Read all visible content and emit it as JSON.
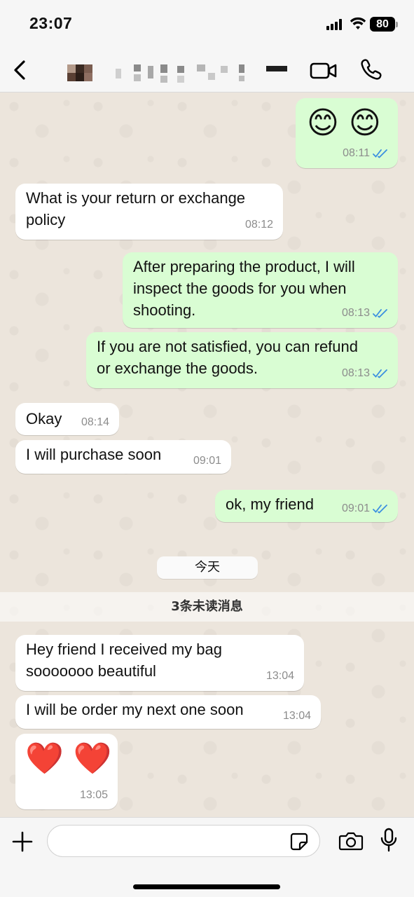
{
  "status_bar": {
    "time": "23:07",
    "battery": "80"
  },
  "chat": {
    "messages": [
      {
        "text": "😊 😊",
        "time": "08:11"
      },
      {
        "text": "What is your return or exchange\npolicy",
        "time": "08:12"
      },
      {
        "text": "After preparing the product, I will\ninspect the goods for you when\nshooting.",
        "time": "08:13"
      },
      {
        "text": "If you are not satisfied, you can refund\nor exchange the goods.",
        "time": "08:13"
      },
      {
        "text": "Okay",
        "time": "08:14"
      },
      {
        "text": "I will purchase soon",
        "time": "09:01"
      },
      {
        "text": "ok, my friend",
        "time": "09:01"
      },
      {
        "text": "Hey friend I received my bag\nsooooooo beautiful",
        "time": "13:04"
      },
      {
        "text": "I will be order my next one soon",
        "time": "13:04"
      },
      {
        "text": "❤️ ❤️",
        "time": "13:05"
      }
    ],
    "day_label": "今天",
    "unread_label": "3条未读消息"
  },
  "icons": {
    "back": "chevron-left-icon",
    "video": "video-camera-icon",
    "call": "phone-icon",
    "ticks": "double-check-icon",
    "plus": "plus-icon",
    "sticker": "sticker-icon",
    "camera": "camera-icon",
    "mic": "microphone-icon"
  },
  "colors": {
    "outgoing_bubble": "#d9fdd3",
    "incoming_bubble": "#ffffff",
    "read_ticks": "#3b8fe0",
    "chat_background": "#ece5dc"
  }
}
